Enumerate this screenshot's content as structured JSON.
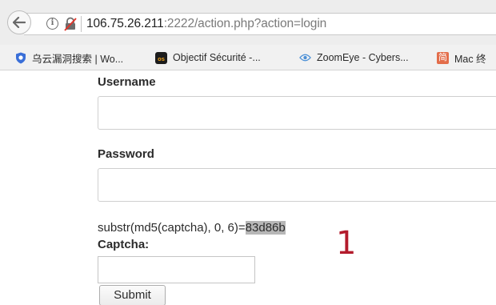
{
  "browser": {
    "url_host": "106.75.26.211",
    "url_rest": ":2222/action.php?action=login",
    "info_glyph": "i"
  },
  "bookmarks": [
    {
      "label": "乌云漏洞搜索 | Wo...",
      "icon": "shield-icon",
      "color": "#3a6fd8"
    },
    {
      "label": "Objectif Sécurité -...",
      "icon": "os-logo-icon",
      "color": "#1c1c1c"
    },
    {
      "label": "ZoomEye - Cybers...",
      "icon": "eye-icon",
      "color": "#4a8fd6"
    },
    {
      "label": "Mac 终",
      "icon": "jian-icon",
      "icon_text": "简",
      "color": "#e36d4a"
    }
  ],
  "form": {
    "username_label": "Username",
    "password_label": "Password",
    "hint_prefix": "substr(md5(captcha), 0, 6)=",
    "hint_value": "83d86b",
    "captcha_label": "Captcha:",
    "submit_label": "Submit"
  },
  "annotation": "1"
}
